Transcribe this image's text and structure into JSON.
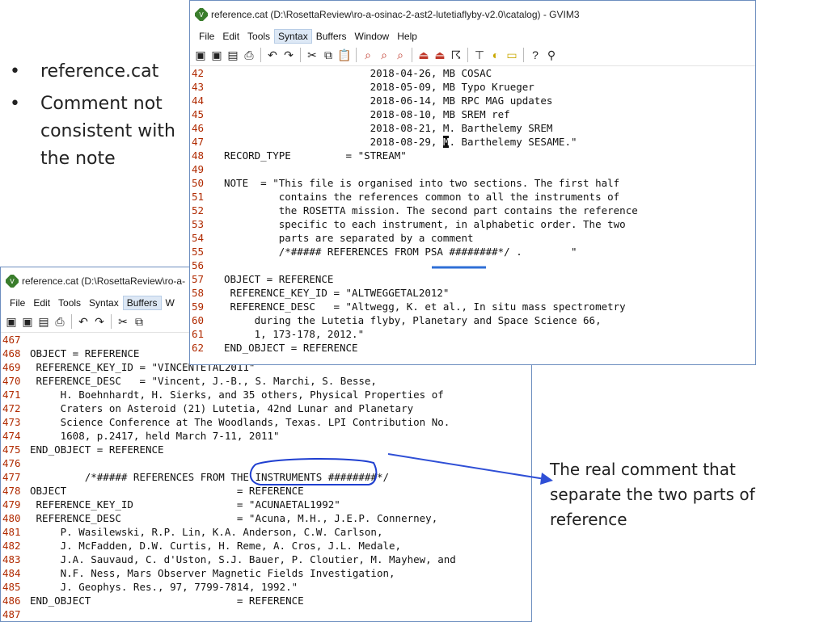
{
  "bullets": [
    "reference.cat",
    "Comment not consistent with the note"
  ],
  "note_text": "The real comment that separate the two parts of reference",
  "front": {
    "title": "reference.cat (D:\\RosettaReview\\ro-a-osinac-2-ast2-lutetiaflyby-v2.0\\catalog) - GVIM3",
    "menu": [
      "File",
      "Edit",
      "Tools",
      "Syntax",
      "Buffers",
      "Window",
      "Help"
    ],
    "lines": [
      {
        "n": "42",
        "t": "                        2018-04-26, MB COSAC"
      },
      {
        "n": "43",
        "t": "                        2018-05-09, MB Typo Krueger"
      },
      {
        "n": "44",
        "t": "                        2018-06-14, MB RPC MAG updates"
      },
      {
        "n": "45",
        "t": "                        2018-08-10, MB SREM ref"
      },
      {
        "n": "46",
        "t": "                        2018-08-21, M. Barthelemy SREM"
      },
      {
        "n": "47",
        "a": "                        2018-08-29, ",
        "c": "M",
        "b": ". Barthelemy SESAME.\""
      },
      {
        "n": "48",
        "t": "RECORD_TYPE         = \"STREAM\""
      },
      {
        "n": "49",
        "t": ""
      },
      {
        "n": "50",
        "t": "NOTE  = \"This file is organised into two sections. The first half"
      },
      {
        "n": "51",
        "t": "         contains the references common to all the instruments of"
      },
      {
        "n": "52",
        "t": "         the ROSETTA mission. The second part contains the reference"
      },
      {
        "n": "53",
        "t": "         specific to each instrument, in alphabetic order. The two"
      },
      {
        "n": "54",
        "t": "         parts are separated by a comment"
      },
      {
        "n": "55",
        "t": "         /*##### REFERENCES FROM PSA ########*/ .        \""
      },
      {
        "n": "56",
        "t": ""
      },
      {
        "n": "57",
        "t": "OBJECT = REFERENCE"
      },
      {
        "n": "58",
        "t": " REFERENCE_KEY_ID = \"ALTWEGGETAL2012\""
      },
      {
        "n": "59",
        "t": " REFERENCE_DESC   = \"Altwegg, K. et al., In situ mass spectrometry"
      },
      {
        "n": "60",
        "t": "     during the Lutetia flyby, Planetary and Space Science 66,"
      },
      {
        "n": "61",
        "t": "     1, 173-178, 2012.\""
      },
      {
        "n": "62",
        "t": "END_OBJECT = REFERENCE"
      }
    ]
  },
  "back": {
    "title": "reference.cat (D:\\RosettaReview\\ro-a-",
    "menu": [
      "File",
      "Edit",
      "Tools",
      "Syntax",
      "Buffers",
      "W"
    ],
    "lines": [
      {
        "n": "467",
        "t": ""
      },
      {
        "n": "468",
        "t": "OBJECT = REFERENCE"
      },
      {
        "n": "469",
        "t": " REFERENCE_KEY_ID = \"VINCENTETAL2011\""
      },
      {
        "n": "470",
        "t": " REFERENCE_DESC   = \"Vincent, J.-B., S. Marchi, S. Besse,"
      },
      {
        "n": "471",
        "t": "     H. Boehnhardt, H. Sierks, and 35 others, Physical Properties of"
      },
      {
        "n": "472",
        "t": "     Craters on Asteroid (21) Lutetia, 42nd Lunar and Planetary"
      },
      {
        "n": "473",
        "t": "     Science Conference at The Woodlands, Texas. LPI Contribution No."
      },
      {
        "n": "474",
        "t": "     1608, p.2417, held March 7-11, 2011\""
      },
      {
        "n": "475",
        "t": "END_OBJECT = REFERENCE"
      },
      {
        "n": "476",
        "t": ""
      },
      {
        "n": "477",
        "t": "         /*##### REFERENCES FROM THE INSTRUMENTS ########*/"
      },
      {
        "n": "478",
        "t": "OBJECT                            = REFERENCE"
      },
      {
        "n": "479",
        "t": " REFERENCE_KEY_ID                 = \"ACUNAETAL1992\""
      },
      {
        "n": "480",
        "t": " REFERENCE_DESC                   = \"Acuna, M.H., J.E.P. Connerney,"
      },
      {
        "n": "481",
        "t": "     P. Wasilewski, R.P. Lin, K.A. Anderson, C.W. Carlson,"
      },
      {
        "n": "482",
        "t": "     J. McFadden, D.W. Curtis, H. Reme, A. Cros, J.L. Medale,"
      },
      {
        "n": "483",
        "t": "     J.A. Sauvaud, C. d'Uston, S.J. Bauer, P. Cloutier, M. Mayhew, and"
      },
      {
        "n": "484",
        "t": "     N.F. Ness, Mars Observer Magnetic Fields Investigation,"
      },
      {
        "n": "485",
        "t": "     J. Geophys. Res., 97, 7799-7814, 1992.\""
      },
      {
        "n": "486",
        "t": "END_OBJECT                        = REFERENCE"
      },
      {
        "n": "487",
        "t": ""
      }
    ]
  }
}
